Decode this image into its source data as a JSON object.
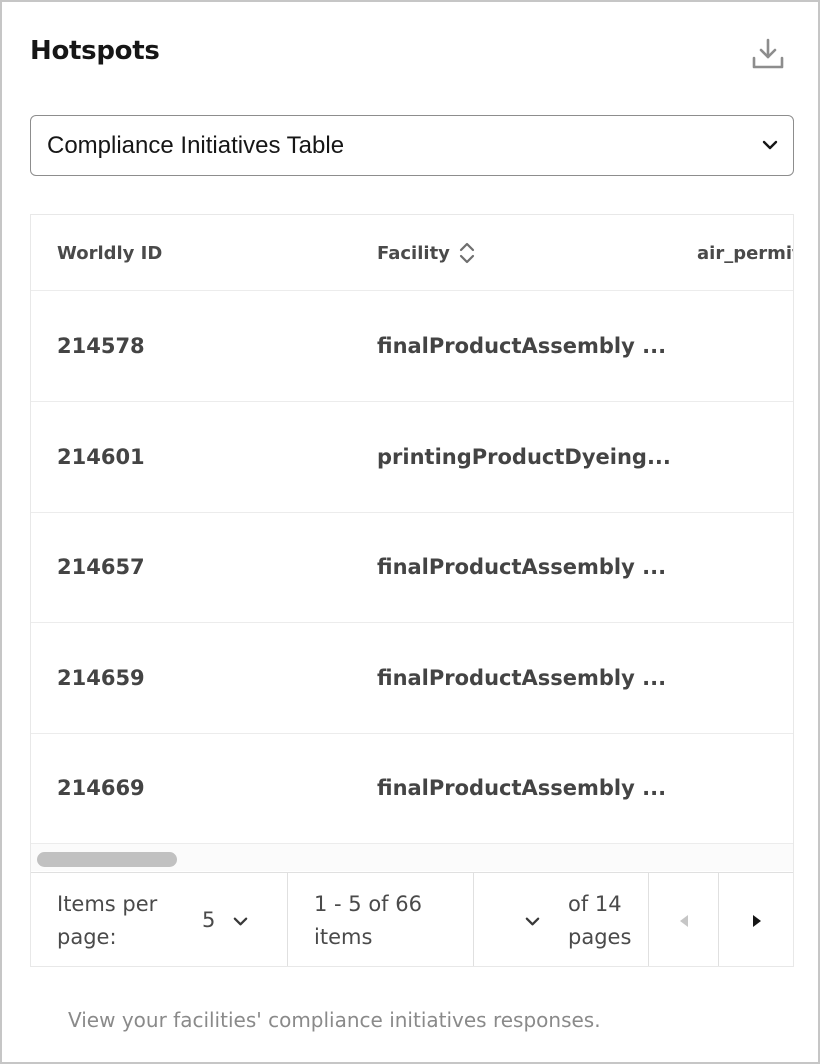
{
  "header": {
    "title": "Hotspots",
    "download_icon": "download-icon"
  },
  "report_select": {
    "value": "Compliance Initiatives Table",
    "icon": "chevron-down-icon"
  },
  "table": {
    "columns": [
      {
        "label": "Worldly ID"
      },
      {
        "label": "Facility",
        "sortable": true
      },
      {
        "label": "air_permit"
      }
    ],
    "rows": [
      {
        "id": "214578",
        "facility": "finalProductAssembly ..."
      },
      {
        "id": "214601",
        "facility": "printingProductDyeing..."
      },
      {
        "id": "214657",
        "facility": "finalProductAssembly ..."
      },
      {
        "id": "214659",
        "facility": "finalProductAssembly ..."
      },
      {
        "id": "214669",
        "facility": "finalProductAssembly ..."
      }
    ]
  },
  "pagination": {
    "items_per_page_label": "Items per page:",
    "items_per_page_value": "5",
    "range_text": "1 - 5 of 66 items",
    "of_pages_text": "of 14 pages",
    "current_page": "",
    "prev_icon": "caret-left-icon",
    "next_icon": "caret-right-icon"
  },
  "footer": {
    "description": "View your facilities' compliance initiatives responses."
  },
  "colors": {
    "text_primary": "#161616",
    "text_secondary": "#4a4a4a",
    "muted": "#8a8a8a",
    "border": "#c6c6c6",
    "disabled": "#c6c6c6"
  }
}
